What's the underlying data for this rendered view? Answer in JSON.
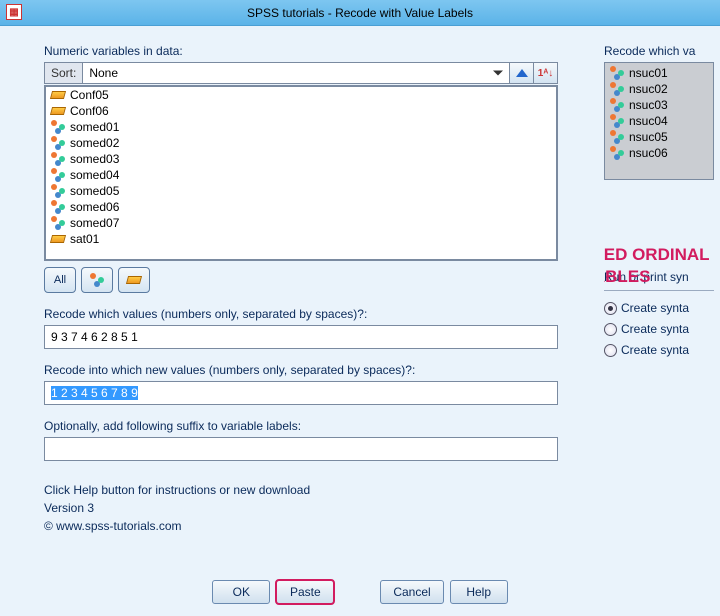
{
  "title": "SPSS tutorials - Recode with Value Labels",
  "left": {
    "heading": "Numeric variables in data:",
    "sort_label": "Sort:",
    "sort_value": "None",
    "vars": [
      {
        "name": "Conf05",
        "icon": "ruler"
      },
      {
        "name": "Conf06",
        "icon": "ruler"
      },
      {
        "name": "somed01",
        "icon": "nominal"
      },
      {
        "name": "somed02",
        "icon": "nominal"
      },
      {
        "name": "somed03",
        "icon": "nominal"
      },
      {
        "name": "somed04",
        "icon": "nominal"
      },
      {
        "name": "somed05",
        "icon": "nominal"
      },
      {
        "name": "somed06",
        "icon": "nominal"
      },
      {
        "name": "somed07",
        "icon": "nominal"
      },
      {
        "name": "sat01",
        "icon": "ruler"
      }
    ],
    "filter_all": "All",
    "recode_which_label": "Recode which values (numbers only, separated by spaces)?:",
    "recode_which_value": "9 3 7 4 6 2 8 5 1",
    "recode_into_label": "Recode into which new values (numbers only, separated by spaces)?:",
    "recode_into_value": "1 2 3 4 5 6 7 8 9",
    "suffix_label": "Optionally, add following suffix to variable labels:",
    "suffix_value": "",
    "help_text": "Click Help button for instructions or new download",
    "version": "Version 3",
    "copyright": "© www.spss-tutorials.com"
  },
  "right": {
    "heading": "Recode which va",
    "vars": [
      "nsuc01",
      "nsuc02",
      "nsuc03",
      "nsuc04",
      "nsuc05",
      "nsuc06"
    ],
    "annotation": "AUTORECODED ORDINAL VARIABLES",
    "section2_heading": "Run or print syn",
    "radios": [
      "Create synta",
      "Create synta",
      "Create synta"
    ],
    "selected_radio": 0
  },
  "buttons": {
    "ok": "OK",
    "paste": "Paste",
    "cancel": "Cancel",
    "help": "Help"
  }
}
